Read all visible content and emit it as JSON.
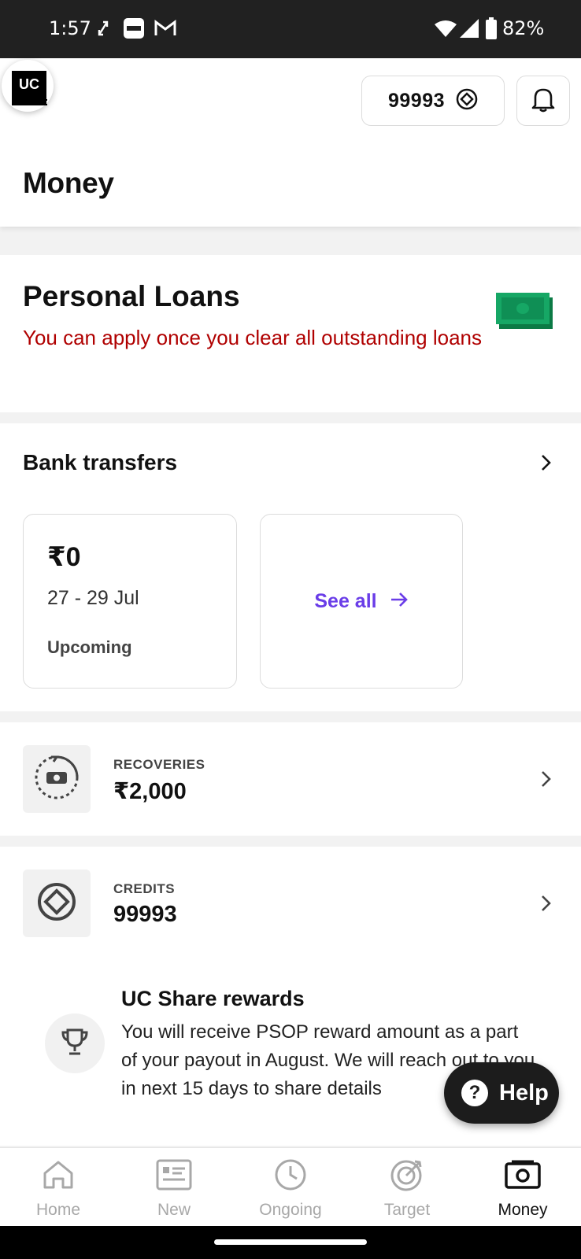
{
  "status_bar": {
    "time": "1:57",
    "battery": "82%"
  },
  "header": {
    "logo_text": "UC",
    "credits_value": "99993",
    "page_title": "Money"
  },
  "personal_loans": {
    "title": "Personal Loans",
    "message": "You can apply once you clear all outstanding loans"
  },
  "bank_transfers": {
    "title": "Bank transfers",
    "card": {
      "amount": "₹0",
      "dates": "27 - 29 Jul",
      "status": "Upcoming"
    },
    "see_all": "See all"
  },
  "recoveries": {
    "label": "RECOVERIES",
    "value": "₹2,000"
  },
  "credits": {
    "label": "CREDITS",
    "value": "99993"
  },
  "uc_share": {
    "title": "UC Share rewards",
    "body": "You will receive PSOP reward amount as a part of your payout in August. We will reach out to you in next 15 days to share details"
  },
  "help": {
    "label": "Help"
  },
  "bottom_nav": {
    "items": [
      {
        "label": "Home",
        "icon": "home-icon"
      },
      {
        "label": "New",
        "icon": "new-jobs-icon"
      },
      {
        "label": "Ongoing",
        "icon": "clock-icon"
      },
      {
        "label": "Target",
        "icon": "target-icon"
      },
      {
        "label": "Money",
        "icon": "money-icon"
      }
    ],
    "active": "Money"
  },
  "colors": {
    "accent": "#6a3de8",
    "error": "#b00000",
    "cash_green": "#0f9d58"
  }
}
